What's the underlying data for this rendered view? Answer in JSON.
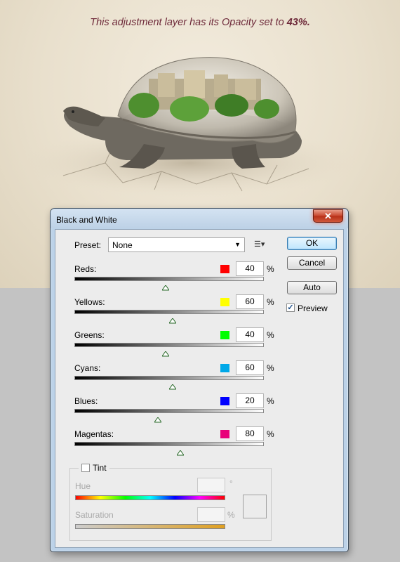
{
  "caption": {
    "prefix": "This adjustment layer has its Opacity set to ",
    "value": "43%."
  },
  "dialog": {
    "title": "Black and White",
    "close_glyph": "✕",
    "preset": {
      "label": "Preset:",
      "value": "None"
    },
    "buttons": {
      "ok": "OK",
      "cancel": "Cancel",
      "auto": "Auto"
    },
    "preview": {
      "label": "Preview",
      "checked": true
    },
    "channels": [
      {
        "label": "Reds:",
        "value": "40",
        "unit": "%",
        "color": "#ff0000"
      },
      {
        "label": "Yellows:",
        "value": "60",
        "unit": "%",
        "color": "#ffff00"
      },
      {
        "label": "Greens:",
        "value": "40",
        "unit": "%",
        "color": "#00ff00"
      },
      {
        "label": "Cyans:",
        "value": "60",
        "unit": "%",
        "color": "#00a8e8"
      },
      {
        "label": "Blues:",
        "value": "20",
        "unit": "%",
        "color": "#0000ff"
      },
      {
        "label": "Magentas:",
        "value": "80",
        "unit": "%",
        "color": "#e8007a"
      }
    ],
    "tint": {
      "label": "Tint",
      "checked": false,
      "hue": {
        "label": "Hue",
        "value": "",
        "unit": "°"
      },
      "saturation": {
        "label": "Saturation",
        "value": "",
        "unit": "%"
      }
    }
  }
}
